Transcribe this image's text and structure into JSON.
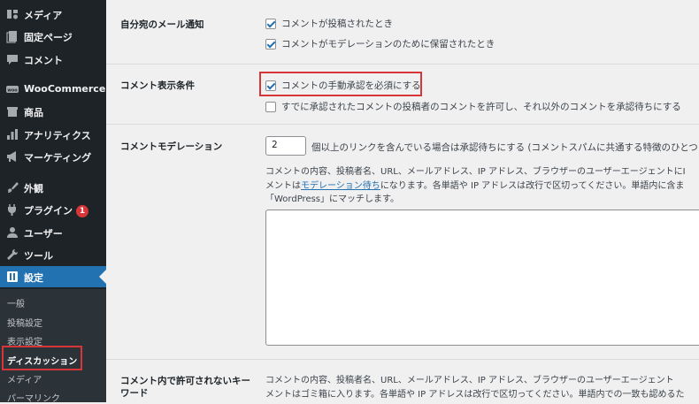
{
  "sidebar": {
    "items": [
      {
        "label": "メディア",
        "icon": "media-icon"
      },
      {
        "label": "固定ページ",
        "icon": "page-icon"
      },
      {
        "label": "コメント",
        "icon": "comment-icon"
      },
      {
        "label": "WooCommerce",
        "icon": "woo-icon"
      },
      {
        "label": "商品",
        "icon": "products-icon"
      },
      {
        "label": "アナリティクス",
        "icon": "analytics-icon"
      },
      {
        "label": "マーケティング",
        "icon": "megaphone-icon"
      },
      {
        "label": "外観",
        "icon": "brush-icon"
      },
      {
        "label": "プラグイン",
        "icon": "plugin-icon",
        "badge": "1"
      },
      {
        "label": "ユーザー",
        "icon": "user-icon"
      },
      {
        "label": "ツール",
        "icon": "wrench-icon"
      },
      {
        "label": "設定",
        "icon": "settings-icon"
      }
    ],
    "submenu": [
      "一般",
      "投稿設定",
      "表示設定",
      "ディスカッション",
      "メディア",
      "パーマリンク"
    ]
  },
  "main": {
    "email_notify": {
      "label": "自分宛のメール通知",
      "options": [
        "コメントが投稿されたとき",
        "コメントがモデレーションのために保留されたとき"
      ]
    },
    "display_conditions": {
      "label": "コメント表示条件",
      "options": [
        "コメントの手動承認を必須にする",
        "すでに承認されたコメントの投稿者のコメントを許可し、それ以外のコメントを承認待ちにする"
      ]
    },
    "moderation": {
      "label": "コメントモデレーション",
      "links_value": "2",
      "links_text": "個以上のリンクを含んでいる場合は承認待ちにする (コメントスパムに共通する特徴のひとつ",
      "desc1": "コメントの内容、投稿者名、URL、メールアドレス、IP アドレス、ブラウザーのユーザーエージェントにI",
      "desc2_pre": "メントは",
      "desc2_link": "モデレーション待ち",
      "desc2_post": "になります。各単語や IP アドレスは改行で区切ってください。単語内に含ま",
      "desc3": "「WordPress」にマッチします。"
    },
    "disallowed": {
      "label_line1": "コメント内で許可されないキー",
      "label_line2": "ワード",
      "desc1": "コメントの内容、投稿者名、URL、メールアドレス、IP アドレス、ブラウザーのユーザーエージェント",
      "desc2": "メントはゴミ箱に入ります。各単語や IP アドレスは改行で区切ってください。単語内での一致も認めるた"
    }
  }
}
